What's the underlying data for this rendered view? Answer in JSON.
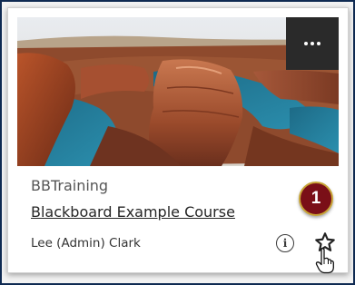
{
  "card": {
    "course_id": "BBTraining",
    "course_name": "Blackboard Example Course",
    "instructor": "Lee (Admin) Clark",
    "info_glyph": "i",
    "more_icon": "ellipsis-icon",
    "star_icon": "star-outline-icon"
  },
  "callout": {
    "step_number": "1",
    "color": "#7a0f17",
    "border_color": "#c8a536"
  },
  "colors": {
    "frame_border": "#0f2a52",
    "menu_button_bg": "#2a2a2a"
  }
}
